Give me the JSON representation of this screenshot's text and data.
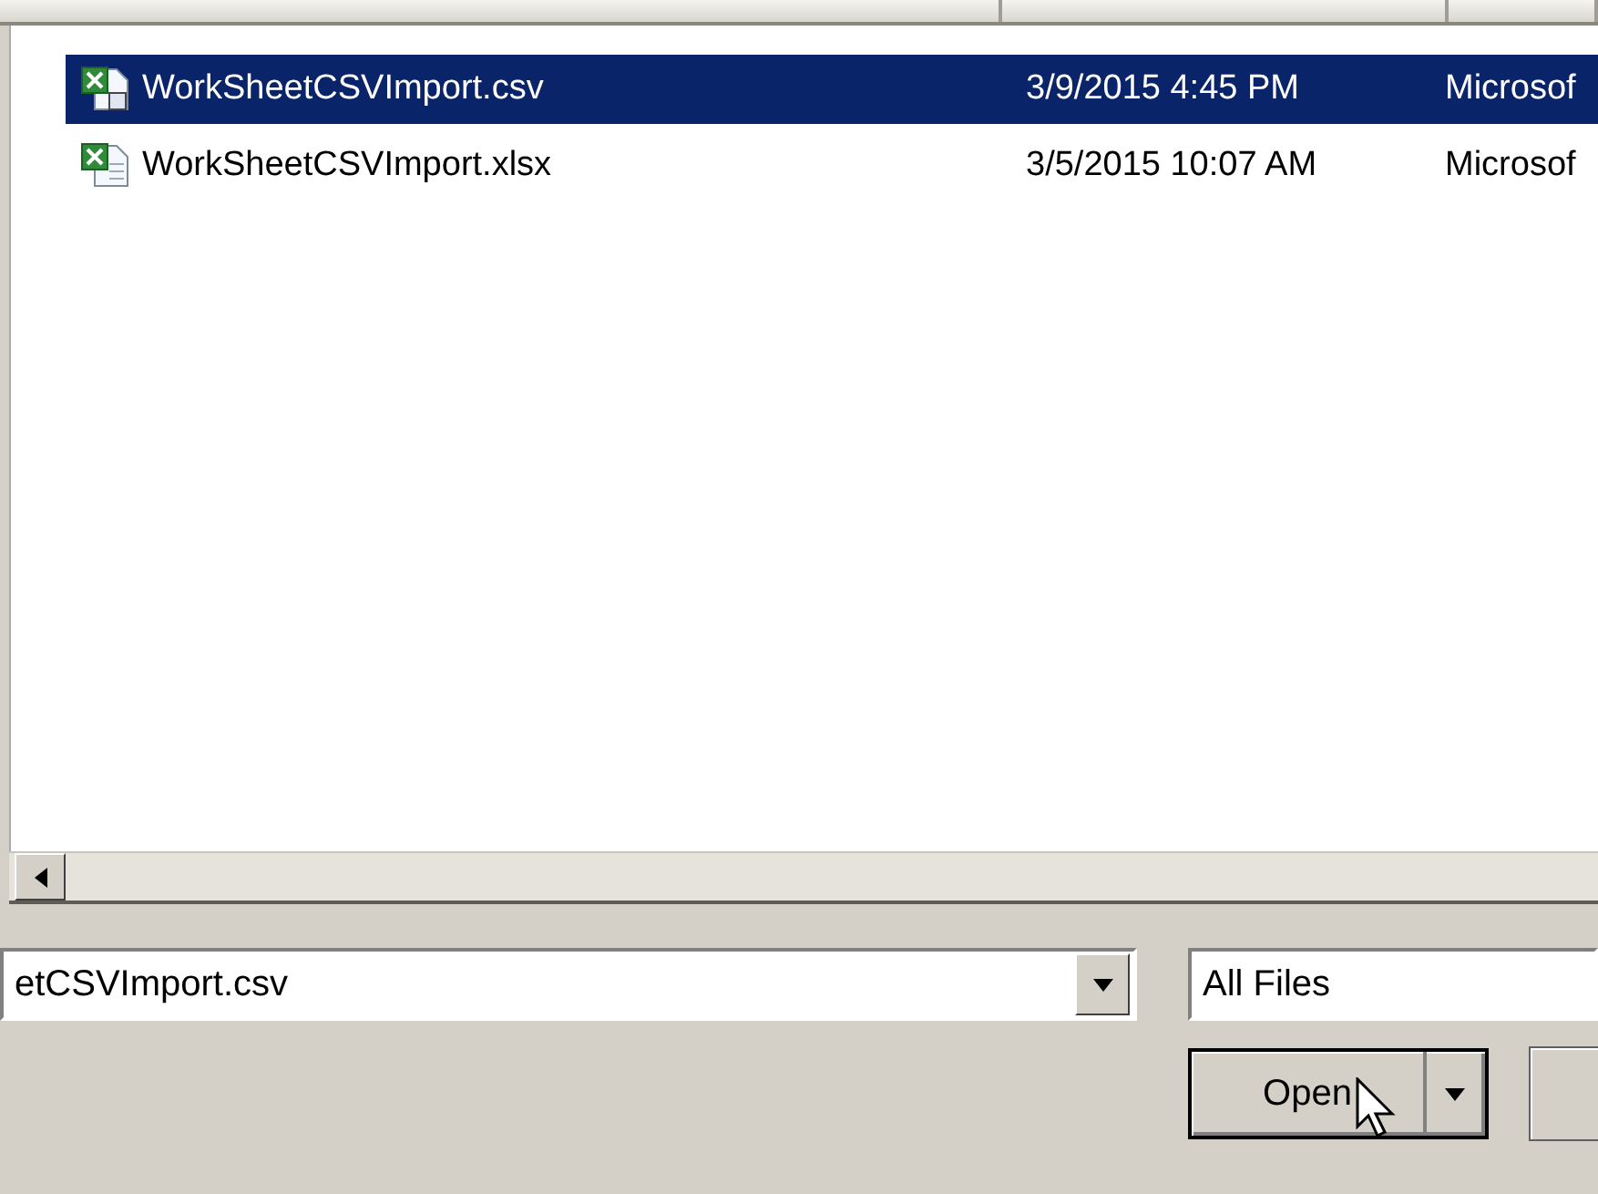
{
  "files": [
    {
      "name": "WorkSheetCSVImport.csv",
      "date": "3/9/2015 4:45 PM",
      "type": "Microsof",
      "kind": "csv",
      "selected": true
    },
    {
      "name": "WorkSheetCSVImport.xlsx",
      "date": "3/5/2015 10:07 AM",
      "type": "Microsof",
      "kind": "xlsx",
      "selected": false
    }
  ],
  "file_name": {
    "value": "etCSVImport.csv"
  },
  "file_type": {
    "value": "All Files"
  },
  "open_button": {
    "label": "Open"
  }
}
